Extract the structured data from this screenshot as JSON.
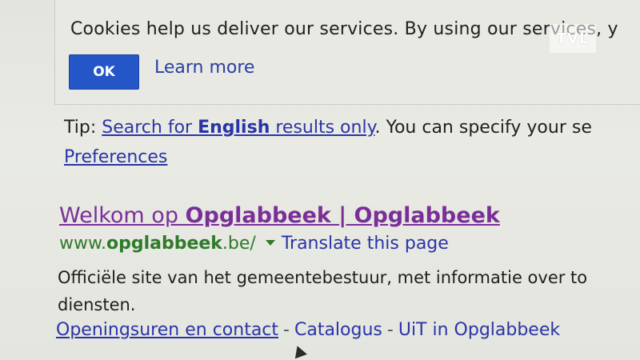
{
  "cookie_banner": {
    "text": "Cookies help us deliver our services. By using our services, y",
    "ok_label": "OK",
    "learn_more_label": "Learn more"
  },
  "watermark": {
    "label": "TVL"
  },
  "tip": {
    "prefix": "Tip: ",
    "link_before": "Search for ",
    "link_bold": "English",
    "link_after": " results only",
    "suffix": ". You can specify your se",
    "preferences_label": "Preferences"
  },
  "result": {
    "title_prefix": "Welkom op ",
    "title_bold": "Opglabbeek | Opglabbeek",
    "url_prefix": "www.",
    "url_bold": "opglabbeek",
    "url_suffix": ".be/",
    "translate_label": "Translate this page",
    "snippet_line1": "Officiële site van het gemeentebestuur, met informatie over to",
    "snippet_line2": "diensten.",
    "sitelinks": [
      "Openingsuren en contact",
      "Catalogus",
      "UiT in Opglabbeek"
    ],
    "sitelink_separator": "-"
  }
}
